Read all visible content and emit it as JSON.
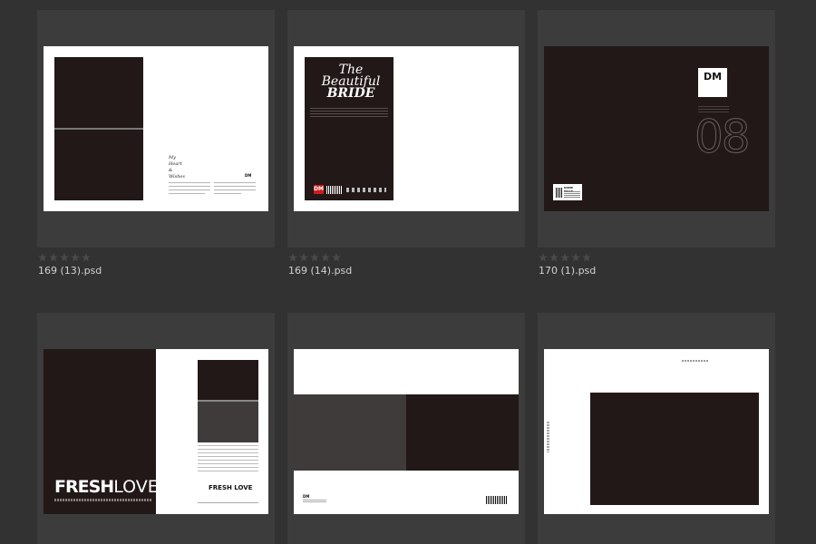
{
  "files": [
    {
      "name": "169 (13).psd",
      "rating": 0
    },
    {
      "name": "169 (14).psd",
      "rating": 0
    },
    {
      "name": "170 (1).psd",
      "rating": 0
    },
    {
      "name": "",
      "rating": 0
    },
    {
      "name": "",
      "rating": 0
    },
    {
      "name": "",
      "rating": 0
    }
  ],
  "thumbs": {
    "t1": {
      "caption": [
        "My",
        "Heart",
        "&",
        "Wishes"
      ],
      "brand": "DM"
    },
    "t2": {
      "title": [
        "The",
        "Beautiful",
        "BRIDE"
      ],
      "brand": "DM"
    },
    "t3": {
      "logo": "DM",
      "number": "08",
      "sticker": "DOME PRICE"
    },
    "t4": {
      "headline_bold": "FRESH",
      "headline_light": "LOVE",
      "small_title": "FRESH LOVE"
    },
    "t5": {
      "brand": "DM"
    },
    "t6": {}
  },
  "colors": {
    "background": "#323232",
    "card": "#3c3c3c",
    "dark_page": "#221818",
    "star": "#4a4a4a"
  }
}
